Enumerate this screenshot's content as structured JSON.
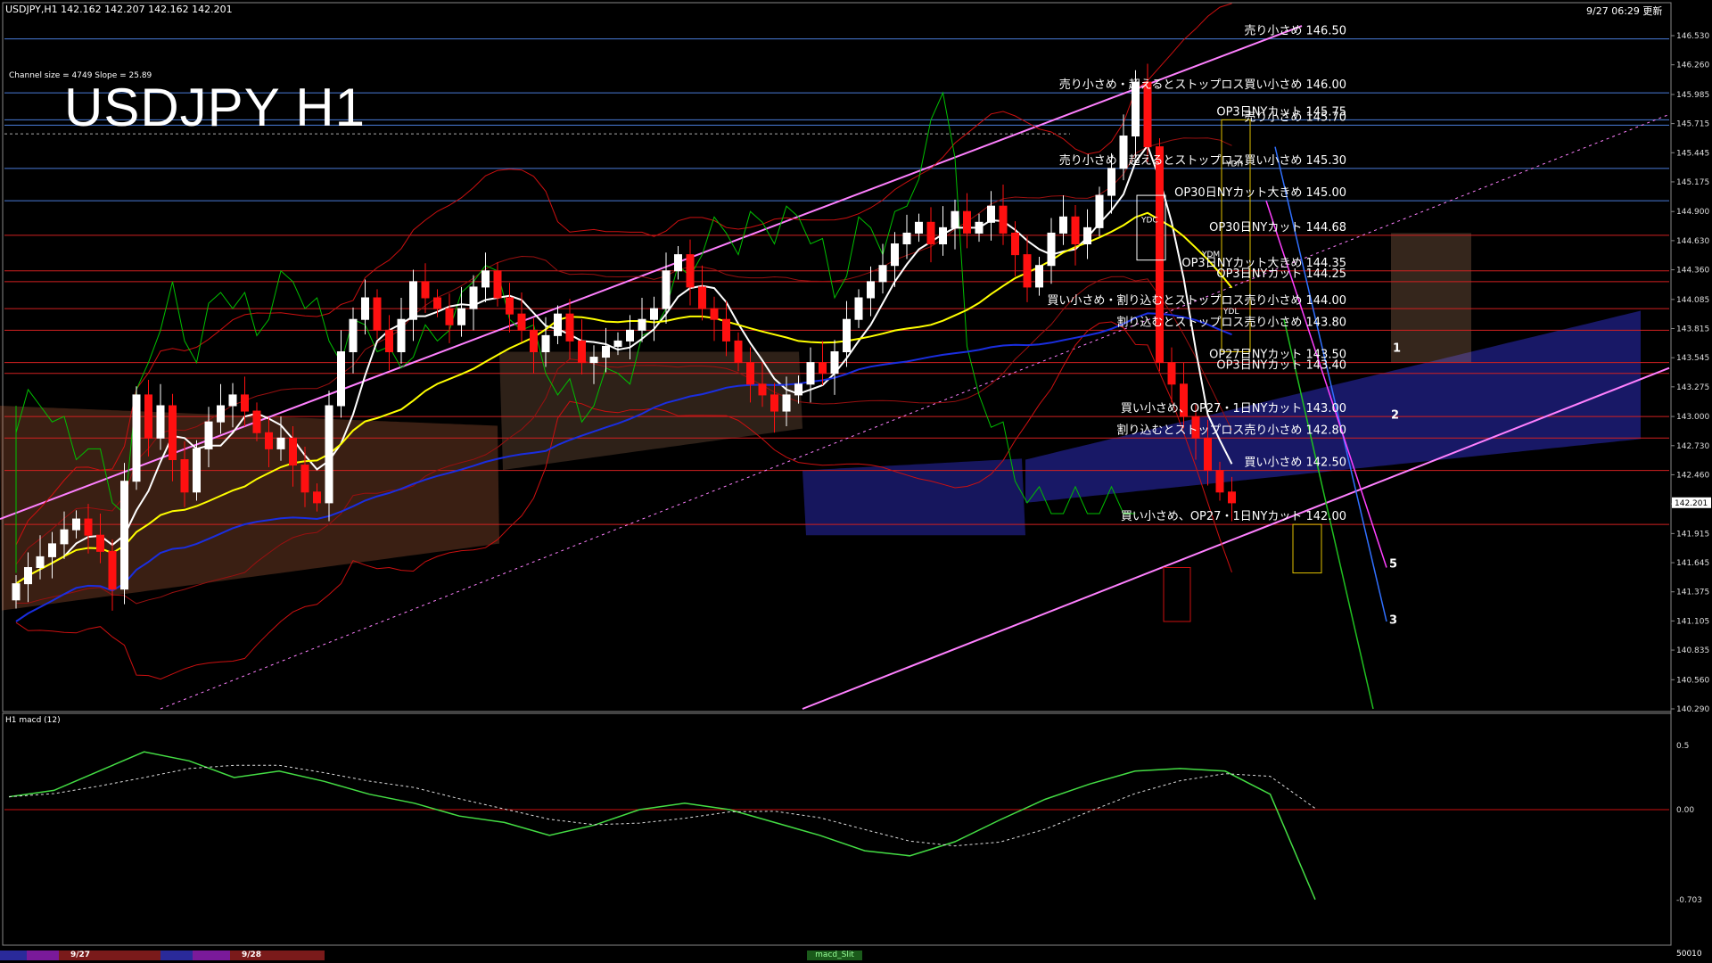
{
  "window": {
    "symbol_info": "USDJPY,H1  142.162 142.207 142.162 142.201",
    "timestamp": "9/27 06:29 更新"
  },
  "overlay": {
    "title": "USDJPY H1",
    "channel_info": "Channel size = 4749 Slope = 25.89"
  },
  "price_axis": {
    "ticks": [
      "146.530",
      "146.260",
      "145.985",
      "145.715",
      "145.445",
      "145.175",
      "144.900",
      "144.630",
      "144.360",
      "144.085",
      "143.815",
      "143.545",
      "143.275",
      "143.000",
      "142.730",
      "142.460",
      "142.190",
      "141.915",
      "141.645",
      "141.375",
      "141.105",
      "140.835",
      "140.560",
      "140.290"
    ],
    "current_price": "142.201"
  },
  "levels": [
    {
      "label": "売り小さめ 146.50",
      "color": "#4a7bd8"
    },
    {
      "label": "売り小さめ・超えるとストップロス買い小さめ 146.00",
      "color": "#4a7bd8"
    },
    {
      "label": "OP3日NYカット 145.75",
      "color": "#4a7bd8"
    },
    {
      "label": "売り小さめ 145.70",
      "color": "#4a7bd8"
    },
    {
      "label": "売り小さめ・超えるとストップロス買い小さめ 145.30",
      "color": "#4a7bd8"
    },
    {
      "label": "OP30日NYカット大きめ 145.00",
      "color": "#4a7bd8"
    },
    {
      "label": "OP30日NYカット 144.68",
      "color": "#d02020"
    },
    {
      "label": "OP3日NYカット大きめ 144.35",
      "color": "#d02020"
    },
    {
      "label": "OP3日NYカット 144.25",
      "color": "#d02020"
    },
    {
      "label": "買い小さめ・割り込むとストップロス売り小さめ 144.00",
      "color": "#d02020"
    },
    {
      "label": "割り込むとストップロス売り小さめ 143.80",
      "color": "#d02020"
    },
    {
      "label": "OP27日NYカット 143.50",
      "color": "#d02020"
    },
    {
      "label": "OP3日NYカット 143.40",
      "color": "#d02020"
    },
    {
      "label": "買い小さめ、OP27・1日NYカット 143.00",
      "color": "#d02020"
    },
    {
      "label": "割り込むとストップロス売り小さめ 142.80",
      "color": "#d02020"
    },
    {
      "label": "買い小さめ 142.50",
      "color": "#d02020"
    },
    {
      "label": "買い小さめ、OP27・1日NYカット 142.00",
      "color": "#d02020"
    }
  ],
  "markers": {
    "ydh": "YDH",
    "ydl": "YDL",
    "ydc": "YDC",
    "ydm": "YDM",
    "wave_1": "1",
    "wave_2": "2",
    "wave_5": "5",
    "wave_3": "3"
  },
  "macd": {
    "title": "H1  macd (12)",
    "ticks": [
      "0.5",
      "0.00",
      "-0.703"
    ]
  },
  "bottom": {
    "date_1": "9/27",
    "date_2": "9/28",
    "tab_label": "macd_Slit",
    "counter": "50010"
  },
  "chart_data": {
    "type": "candlestick",
    "title": "USDJPY H1",
    "ylim": [
      140.29,
      146.53
    ],
    "series_colors": {
      "bull": "#ffffff",
      "bear": "#ff1010",
      "ma_fast": "#ffffff",
      "ma_mid": "#ffff00",
      "ma_slow": "#1a2ee0",
      "bollinger": "#cc1010",
      "chikou": "#00c000",
      "channel": "#ff80ff",
      "kumo_up": "#e0b080",
      "kumo_down": "#2a2aa0"
    },
    "close": [
      141.45,
      141.6,
      141.7,
      141.82,
      141.95,
      142.05,
      141.9,
      141.75,
      141.4,
      142.4,
      143.2,
      142.8,
      143.1,
      142.6,
      142.3,
      142.7,
      142.95,
      143.1,
      143.2,
      143.05,
      142.85,
      142.7,
      142.8,
      142.55,
      142.3,
      142.2,
      143.1,
      143.6,
      143.9,
      144.1,
      143.8,
      143.6,
      143.9,
      144.25,
      144.1,
      144.0,
      143.85,
      144.0,
      144.2,
      144.35,
      144.1,
      143.95,
      143.8,
      143.6,
      143.75,
      143.95,
      143.7,
      143.5,
      143.55,
      143.65,
      143.7,
      143.8,
      143.9,
      144.0,
      144.35,
      144.5,
      144.2,
      144.0,
      143.9,
      143.7,
      143.5,
      143.3,
      143.2,
      143.05,
      143.2,
      143.3,
      143.5,
      143.4,
      143.6,
      143.9,
      144.1,
      144.25,
      144.4,
      144.6,
      144.7,
      144.8,
      144.6,
      144.75,
      144.9,
      144.7,
      144.8,
      144.95,
      144.7,
      144.5,
      144.2,
      144.4,
      144.7,
      144.85,
      144.6,
      144.75,
      145.05,
      145.3,
      145.6,
      146.1,
      145.5,
      143.5,
      143.3,
      143.0,
      142.8,
      142.5,
      142.3,
      142.2
    ]
  }
}
